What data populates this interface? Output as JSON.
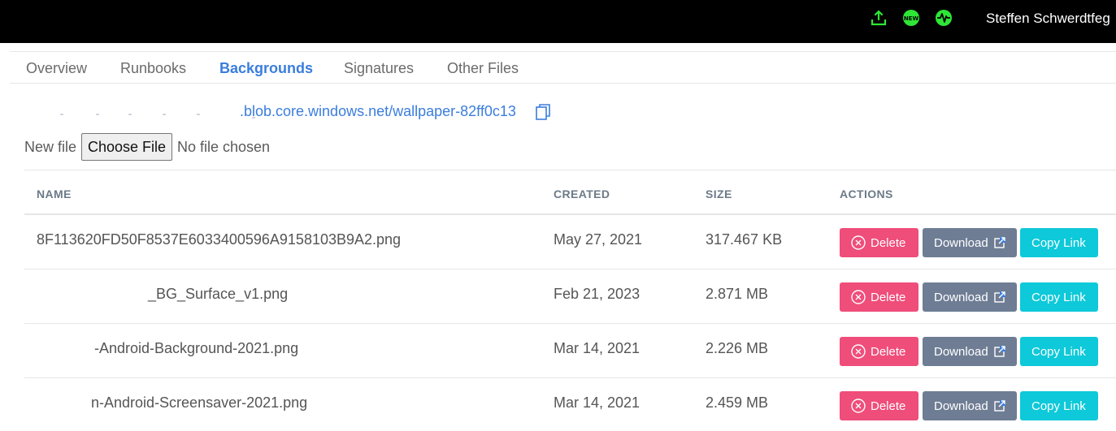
{
  "header": {
    "user_name": "Steffen Schwerdtfeg",
    "icons": [
      "upload-icon",
      "new-badge-icon",
      "activity-icon"
    ],
    "icon_color": "#2ee636"
  },
  "tabs": [
    {
      "label": "Overview",
      "active": false
    },
    {
      "label": "Runbooks",
      "active": false
    },
    {
      "label": "Backgrounds",
      "active": true
    },
    {
      "label": "Signatures",
      "active": false
    },
    {
      "label": "Other Files",
      "active": false
    }
  ],
  "storage": {
    "url": ".blob.core.windows.net/wallpaper-82ff0c13"
  },
  "upload": {
    "label": "New file",
    "button_label": "Choose File",
    "status": "No file chosen"
  },
  "table": {
    "columns": [
      "NAME",
      "CREATED",
      "SIZE",
      "ACTIONS"
    ],
    "rows": [
      {
        "name": "8F113620FD50F8537E6033400596A9158103B9A2.png",
        "created": "May 27, 2021",
        "size": "317.467 KB"
      },
      {
        "name": "_BG_Surface_v1.png",
        "created": "Feb 21, 2023",
        "size": "2.871 MB"
      },
      {
        "name": "-Android-Background-2021.png",
        "created": "Mar 14, 2021",
        "size": "2.226 MB"
      },
      {
        "name": "n-Android-Screensaver-2021.png",
        "created": "Mar 14, 2021",
        "size": "2.459 MB"
      }
    ],
    "actions": {
      "delete": "Delete",
      "download": "Download",
      "copy": "Copy Link"
    }
  },
  "colors": {
    "accent": "#3b7ddd",
    "delete": "#ef4d7a",
    "download": "#6e7d94",
    "copy_link": "#0ec9d9"
  }
}
